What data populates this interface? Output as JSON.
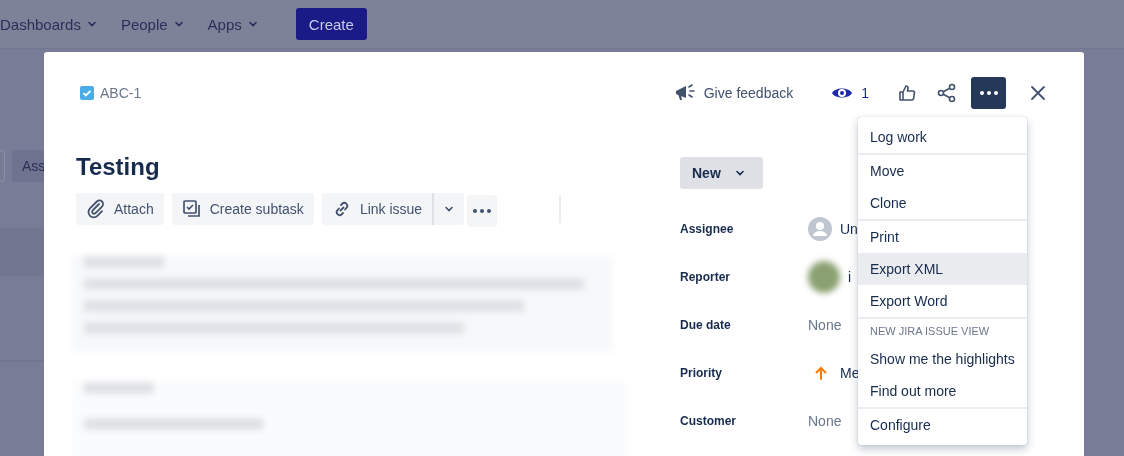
{
  "nav": {
    "items": [
      {
        "label": "Dashboards"
      },
      {
        "label": "People"
      },
      {
        "label": "Apps"
      }
    ],
    "create_button": "Create"
  },
  "background": {
    "button_fragment": "Ass"
  },
  "issue": {
    "key": "ABC-1",
    "title": "Testing",
    "actions": [
      {
        "label": "Attach",
        "kind": "attach"
      },
      {
        "label": "Create subtask",
        "kind": "subtask"
      },
      {
        "label": "Link issue",
        "kind": "link"
      }
    ]
  },
  "toolbar": {
    "feedback": "Give feedback",
    "watchers": "1"
  },
  "status": {
    "label": "New"
  },
  "fields": [
    {
      "label": "Assignee",
      "value": "Un",
      "kind": "avatar"
    },
    {
      "label": "Reporter",
      "value": "i",
      "kind": "blurred_avatar"
    },
    {
      "label": "Due date",
      "value": "None",
      "kind": "empty"
    },
    {
      "label": "Priority",
      "value": "Me",
      "kind": "priority"
    },
    {
      "label": "Customer",
      "value": "None",
      "kind": "empty"
    }
  ],
  "menu": {
    "sections": [
      {
        "items": [
          {
            "label": "Log work",
            "selected": false
          }
        ]
      },
      {
        "items": [
          {
            "label": "Move",
            "selected": false
          },
          {
            "label": "Clone",
            "selected": false
          }
        ]
      },
      {
        "items": [
          {
            "label": "Print",
            "selected": false
          },
          {
            "label": "Export XML",
            "selected": true
          },
          {
            "label": "Export Word",
            "selected": false
          }
        ]
      },
      {
        "heading": "NEW JIRA ISSUE VIEW",
        "items": [
          {
            "label": "Show me the highlights",
            "selected": false
          },
          {
            "label": "Find out more",
            "selected": false
          }
        ]
      },
      {
        "items": [
          {
            "label": "Configure",
            "selected": false
          }
        ]
      }
    ]
  }
}
